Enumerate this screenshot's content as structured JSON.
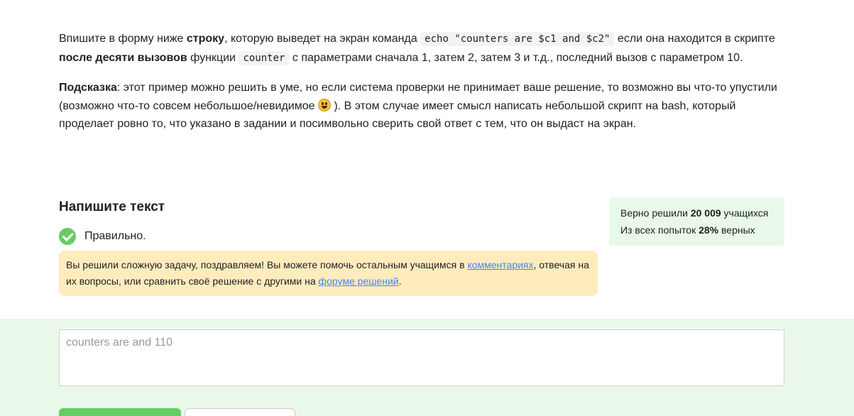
{
  "task": {
    "p1_a": "Впишите в форму ниже ",
    "p1_b": "строку",
    "p1_c": ", которую выведет на экран команда ",
    "p1_code1": "echo \"counters are $c1 and $c2\"",
    "p1_d": " если она находится в скрипте ",
    "p1_e": "после десяти вызовов",
    "p1_f": " функции ",
    "p1_code2": "counter",
    "p1_g": " с параметрами сначала 1, затем 2, затем 3 и т.д., последний вызов с параметром 10.",
    "p2_a": "Подсказка",
    "p2_b": ": этот пример можно решить в уме, но если система проверки не принимает ваше решение, то возможно вы что-то упустили (возможно что-то совсем небольшое/невидимое ",
    "p2_c": " ). В этом случае имеет смысл написать небольшой скрипт на bash, который проделает ровно то, что указано в задании и посимвольно сверить свой ответ с тем, что он выдаст на экран."
  },
  "section_title": "Напишите текст",
  "status": {
    "text": "Правильно.",
    "icon": "check-circle-icon",
    "color": "#66cc66"
  },
  "congrats": {
    "a": "Вы решили сложную задачу, поздравляем! Вы можете помочь остальным учащимся в ",
    "link1": "комментариях",
    "b": ", отвечая на их вопросы, или сравнить своё решение с другими на ",
    "link2": "форуме решений",
    "c": "."
  },
  "stats": {
    "l1_a": "Верно решили ",
    "l1_b": "20 009",
    "l1_c": " учащихся",
    "l2_a": "Из всех попыток ",
    "l2_b": "28%",
    "l2_c": " верных"
  },
  "answer": {
    "value": "counters are  and 110"
  },
  "colors": {
    "accent": "#66cc66",
    "link": "#4485ed",
    "notice_bg": "#ffecbd",
    "stats_bg": "#e9f9e9"
  }
}
